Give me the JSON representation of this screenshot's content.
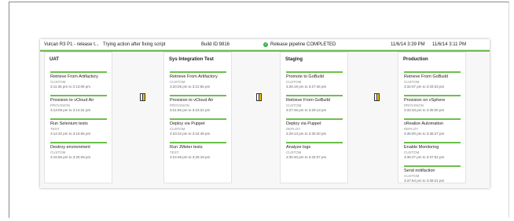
{
  "status_bar": {
    "title": "Vulcan R3 P1 - release t...",
    "action": "Trying action after fixing script",
    "build": "Build ID:9816",
    "status": "Release pipeline COMPLETED",
    "start_time": "11/6/14 3:39 PM",
    "end_time": "11/6/14 3:11 PM",
    "accent_color": "#6cc04a"
  },
  "stages": [
    {
      "name": "UAT",
      "tasks": [
        {
          "name": "Retrieve From Artifactory",
          "type": "CUSTOM",
          "time": "3:11:36 pm to 3:13:09 pm"
        },
        {
          "name": "Provision to vCloud Air",
          "type": "PROVISION",
          "time": "3:13:09 pm to 3:14:31 pm"
        },
        {
          "name": "Run Selenium tests",
          "type": "TEST",
          "time": "3:14:32 pm to 3:15:56 pm"
        },
        {
          "name": "Destroy environment",
          "type": "CUSTOM",
          "time": "3:15:56 pm to 3:20:28 pm"
        }
      ]
    },
    {
      "name": "Sys Integration Test",
      "tasks": [
        {
          "name": "Retrieve From Artifactory",
          "type": "CUSTOM",
          "time": "3:20:28 pm to 3:21:56 pm"
        },
        {
          "name": "Provision to vCloud Air",
          "type": "PROVISION",
          "time": "3:21:56 pm to 3:23:22 pm"
        },
        {
          "name": "Deploy via Puppet",
          "type": "CUSTOM",
          "time": "3:23:22 pm to 3:24:48 pm"
        },
        {
          "name": "Run JMeter tests",
          "type": "TEST",
          "time": "3:24:48 pm to 3:26:19 pm"
        }
      ]
    },
    {
      "name": "Staging",
      "tasks": [
        {
          "name": "Promote to GoBuild",
          "type": "CUSTOM",
          "time": "3:26:19 pm to 3:27:46 pm"
        },
        {
          "name": "Retrieve From GoBuild",
          "type": "CUSTOM",
          "time": "3:27:46 pm to 3:29:13 pm"
        },
        {
          "name": "Deploy via Puppet",
          "type": "DEPLOY",
          "time": "3:29:13 pm to 3:30:40 pm"
        },
        {
          "name": "Analyze logs",
          "type": "CUSTOM",
          "time": "3:30:40 pm to 3:32:07 pm"
        }
      ]
    },
    {
      "name": "Production",
      "tasks": [
        {
          "name": "Retrieve From GoBuild",
          "type": "CUSTOM",
          "time": "3:32:07 pm to 3:33:33 pm"
        },
        {
          "name": "Provision on vSphere",
          "type": "PROVISION",
          "time": "3:33:33 pm to 3:35:00 pm"
        },
        {
          "name": "vRealize Automation",
          "type": "DEPLOY",
          "time": "3:35:00 pm to 3:36:27 pm"
        },
        {
          "name": "Enable Monitoring",
          "type": "CUSTOM",
          "time": "3:36:27 pm to 3:37:54 pm"
        },
        {
          "name": "Send notifaction",
          "type": "CUSTOM",
          "time": "3:37:54 pm to 3:39:21 pm"
        }
      ]
    }
  ]
}
